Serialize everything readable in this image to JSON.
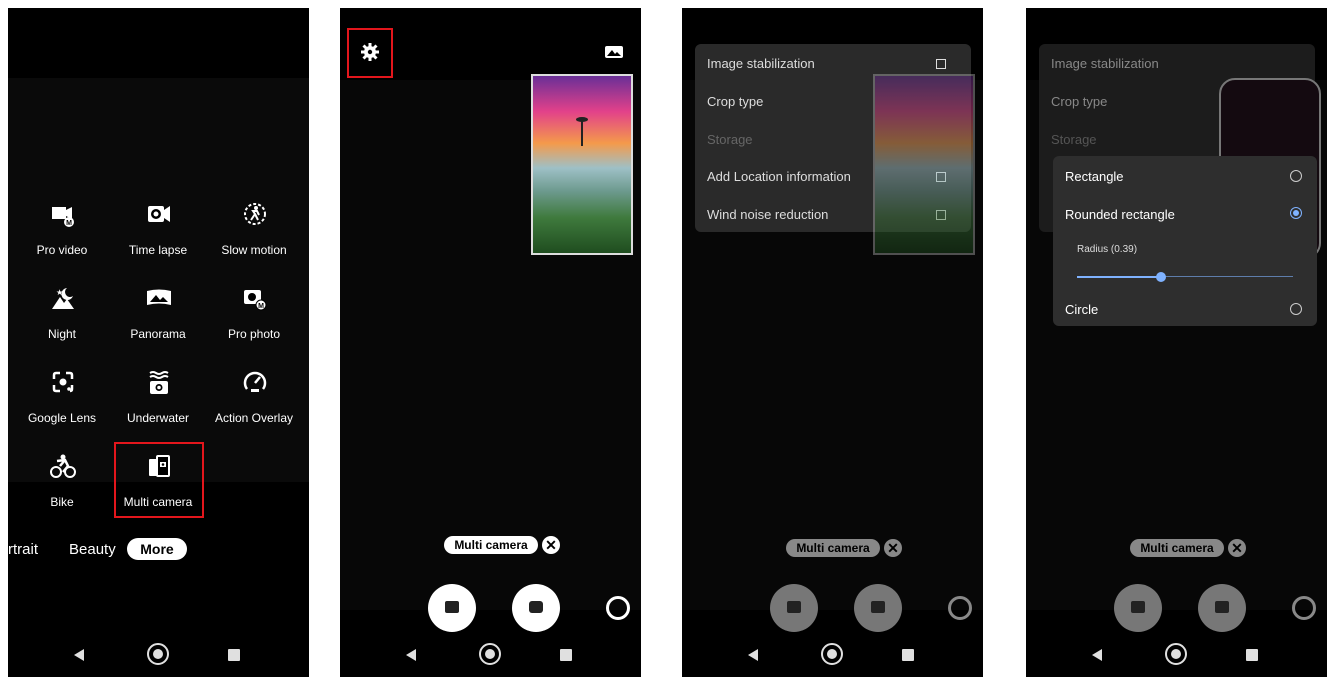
{
  "screen1": {
    "modes": [
      {
        "label": "Pro video",
        "icon": "pro-video-icon"
      },
      {
        "label": "Time lapse",
        "icon": "time-lapse-icon"
      },
      {
        "label": "Slow motion",
        "icon": "slow-motion-icon"
      },
      {
        "label": "Night",
        "icon": "night-icon"
      },
      {
        "label": "Panorama",
        "icon": "panorama-icon"
      },
      {
        "label": "Pro photo",
        "icon": "pro-photo-icon"
      },
      {
        "label": "Google Lens",
        "icon": "google-lens-icon"
      },
      {
        "label": "Underwater",
        "icon": "underwater-icon"
      },
      {
        "label": "Action Overlay",
        "icon": "action-overlay-icon"
      },
      {
        "label": "Bike",
        "icon": "bike-icon"
      },
      {
        "label": "Multi camera",
        "icon": "multi-camera-icon"
      }
    ],
    "tabs": {
      "portrait": "rtrait",
      "beauty": "Beauty",
      "more": "More"
    }
  },
  "screen2": {
    "chip_label": "Multi camera",
    "chip_close": "✕"
  },
  "screen3": {
    "settings": [
      {
        "label": "Image stabilization",
        "checkbox": true,
        "enabled": true
      },
      {
        "label": "Crop type",
        "checkbox": false,
        "enabled": true
      },
      {
        "label": "Storage",
        "checkbox": false,
        "enabled": false
      },
      {
        "label": "Add Location information",
        "checkbox": true,
        "enabled": true
      },
      {
        "label": "Wind noise reduction",
        "checkbox": true,
        "enabled": true
      }
    ],
    "chip_label": "Multi camera",
    "chip_close": "✕"
  },
  "screen4": {
    "settings_bg": [
      "Image stabilization",
      "Crop type",
      "Storage"
    ],
    "crop_options": [
      {
        "label": "Rectangle",
        "selected": false
      },
      {
        "label": "Rounded rectangle",
        "selected": true
      },
      {
        "label": "Circle",
        "selected": false
      }
    ],
    "radius_label": "Radius (0.39)",
    "radius_value": 0.39,
    "chip_label": "Multi camera",
    "chip_close": "✕"
  },
  "colors": {
    "highlight": "#e3161c",
    "accent": "#7fb2ff"
  }
}
